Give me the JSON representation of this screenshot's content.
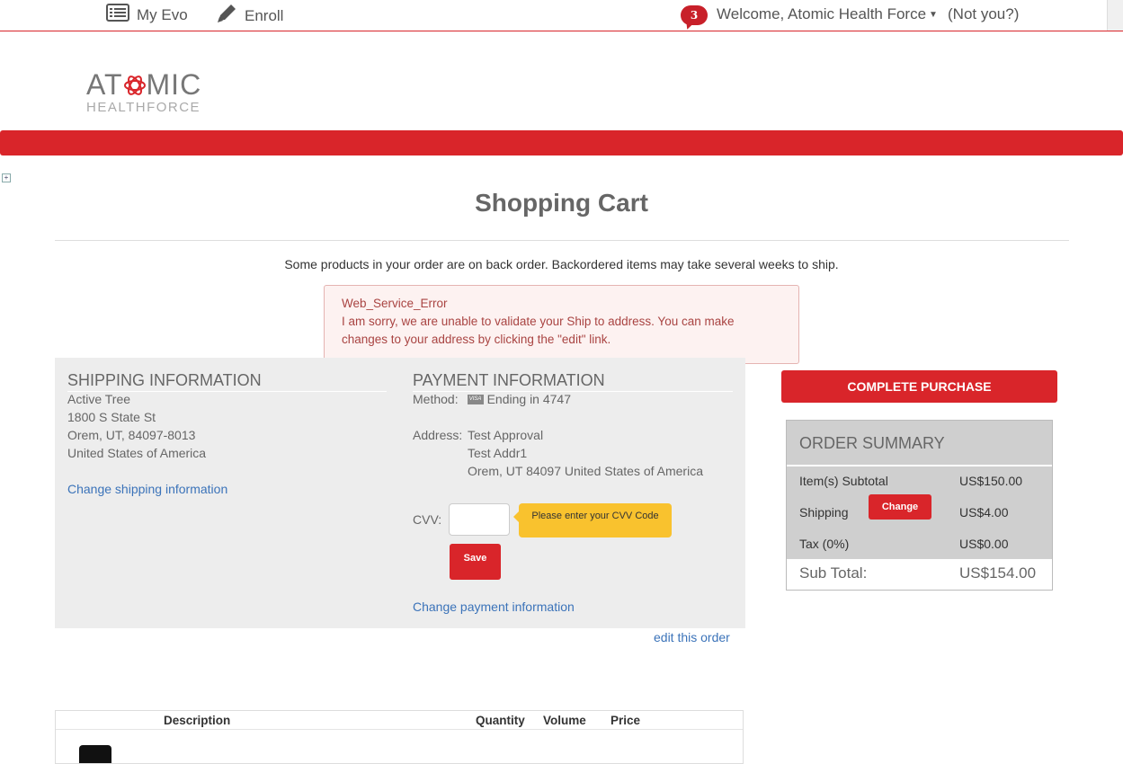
{
  "topnav": {
    "my_evo": "My Evo",
    "enroll": "Enroll",
    "notification_count": "3",
    "welcome": "Welcome, Atomic Health Force",
    "not_you": "(Not you?)"
  },
  "logo": {
    "line1_a": "AT",
    "line1_b": "MIC",
    "line2": "HEALTHFORCE"
  },
  "page": {
    "title": "Shopping Cart",
    "backorder_notice": "Some products in your order are on back order. Backordered items may take several weeks to ship."
  },
  "alert": {
    "title": "Web_Service_Error",
    "message": "I am sorry, we are unable to validate your Ship to address. You can make changes to your address by clicking the \"edit\" link."
  },
  "shipping": {
    "heading": "SHIPPING INFORMATION",
    "name": "Active Tree",
    "street": "1800 S State St",
    "city_line": "Orem, UT, 84097-8013",
    "country": "United States of America",
    "change_link": "Change shipping information"
  },
  "payment": {
    "heading": "PAYMENT INFORMATION",
    "method_label": "Method:",
    "card_brand": "VISA",
    "ending": "Ending in 4747",
    "address_label": "Address:",
    "addr_line1": "Test Approval",
    "addr_line2": "Test Addr1",
    "addr_line3": "Orem, UT 84097 United States of America",
    "cvv_label": "CVV:",
    "cvv_tooltip": "Please enter your CVV Code",
    "save_label": "Save",
    "change_link": "Change payment information"
  },
  "edit_order_link": "edit this order",
  "complete_purchase": "COMPLETE PURCHASE",
  "summary": {
    "heading": "ORDER SUMMARY",
    "subtotal_label": "Item(s) Subtotal",
    "subtotal_value": "US$150.00",
    "shipping_label": "Shipping",
    "shipping_change": "Change",
    "shipping_value": "US$4.00",
    "tax_label": "Tax (0%)",
    "tax_value": "US$0.00",
    "total_label": "Sub Total:",
    "total_value": "US$154.00"
  },
  "products_table": {
    "columns": [
      "Description",
      "Quantity",
      "Volume",
      "Price"
    ]
  },
  "colors": {
    "brand_red": "#d9252a",
    "link_blue": "#3b73b9",
    "tooltip_yellow": "#f9c22e"
  }
}
